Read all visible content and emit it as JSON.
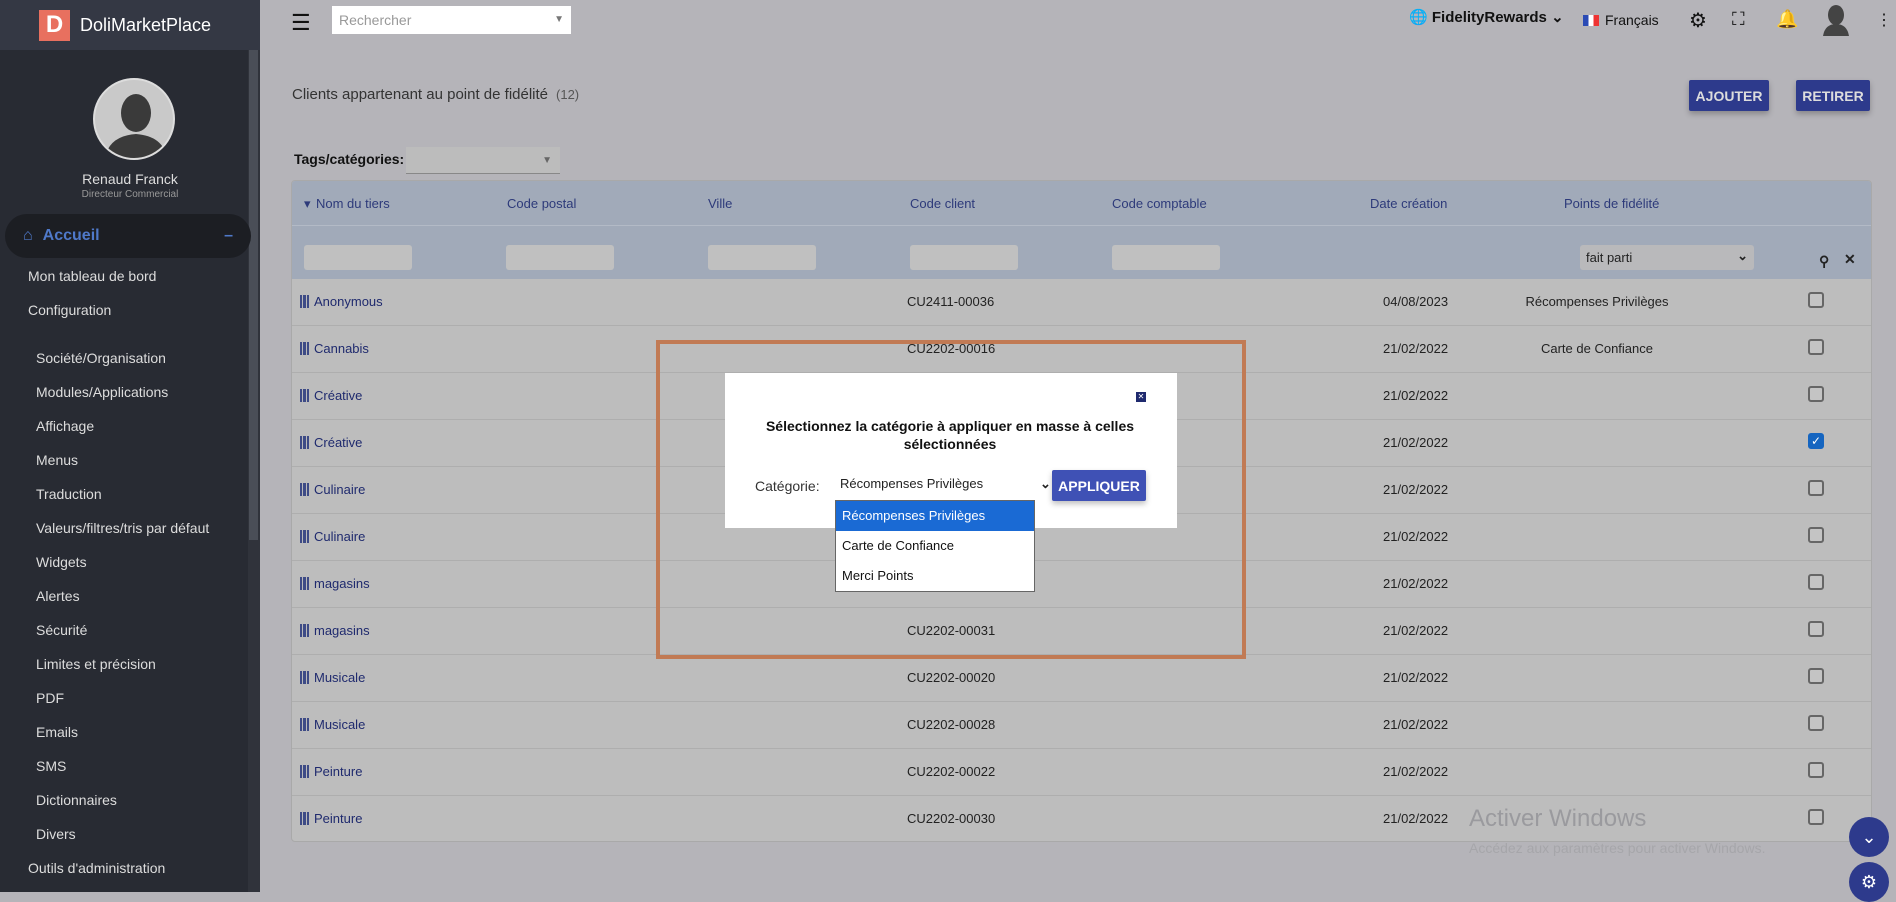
{
  "brand": {
    "logo_letter": "D",
    "name": "DoliMarketPlace"
  },
  "user": {
    "name": "Renaud Franck",
    "role": "Directeur Commercial"
  },
  "sidebar": {
    "accueil": "Accueil",
    "items": [
      "Mon tableau de bord",
      "Configuration"
    ],
    "sub": [
      "Société/Organisation",
      "Modules/Applications",
      "Affichage",
      "Menus",
      "Traduction",
      "Valeurs/filtres/tris par défaut",
      "Widgets",
      "Alertes",
      "Sécurité",
      "Limites et précision",
      "PDF",
      "Emails",
      "SMS",
      "Dictionnaires",
      "Divers"
    ],
    "last": "Outils d'administration"
  },
  "topbar": {
    "search_placeholder": "Rechercher",
    "module": "FidelityRewards",
    "language": "Français"
  },
  "page": {
    "title": "Clients appartenant au point de fidélité",
    "count": "(12)",
    "add": "AJOUTER",
    "remove": "RETIRER",
    "tags_label": "Tags/catégories:"
  },
  "table": {
    "headers": [
      "Nom du tiers",
      "Code postal",
      "Ville",
      "Code client",
      "Code comptable",
      "Date création",
      "Points de fidélité"
    ],
    "points_filter": "fait parti",
    "rows": [
      {
        "name": "Anonymous",
        "code": "CU2411-00036",
        "date": "04/08/2023",
        "points": "Récompenses Privilèges",
        "checked": false
      },
      {
        "name": "Cannabis",
        "code": "CU2202-00016",
        "date": "21/02/2022",
        "points": "Carte de Confiance",
        "checked": false
      },
      {
        "name": "Créative",
        "code": "",
        "date": "21/02/2022",
        "points": "",
        "checked": false
      },
      {
        "name": "Créative",
        "code": "",
        "date": "21/02/2022",
        "points": "",
        "checked": true
      },
      {
        "name": "Culinaire",
        "code": "",
        "date": "21/02/2022",
        "points": "",
        "checked": false
      },
      {
        "name": "Culinaire",
        "code": "",
        "date": "21/02/2022",
        "points": "",
        "checked": false
      },
      {
        "name": "magasins",
        "code": "",
        "date": "21/02/2022",
        "points": "",
        "checked": false
      },
      {
        "name": "magasins",
        "code": "CU2202-00031",
        "date": "21/02/2022",
        "points": "",
        "checked": false
      },
      {
        "name": "Musicale",
        "code": "CU2202-00020",
        "date": "21/02/2022",
        "points": "",
        "checked": false
      },
      {
        "name": "Musicale",
        "code": "CU2202-00028",
        "date": "21/02/2022",
        "points": "",
        "checked": false
      },
      {
        "name": "Peinture",
        "code": "CU2202-00022",
        "date": "21/02/2022",
        "points": "",
        "checked": false
      },
      {
        "name": "Peinture",
        "code": "CU2202-00030",
        "date": "21/02/2022",
        "points": "",
        "checked": false
      }
    ]
  },
  "modal": {
    "title": "Sélectionnez la catégorie à appliquer en masse à celles sélectionnées",
    "label": "Catégorie:",
    "selected": "Récompenses Privilèges",
    "apply": "APPLIQUER",
    "options": [
      "Récompenses Privilèges",
      "Carte de Confiance",
      "Merci Points"
    ]
  },
  "watermark": {
    "title": "Activer Windows",
    "subtitle": "Accédez aux paramètres pour activer Windows."
  }
}
